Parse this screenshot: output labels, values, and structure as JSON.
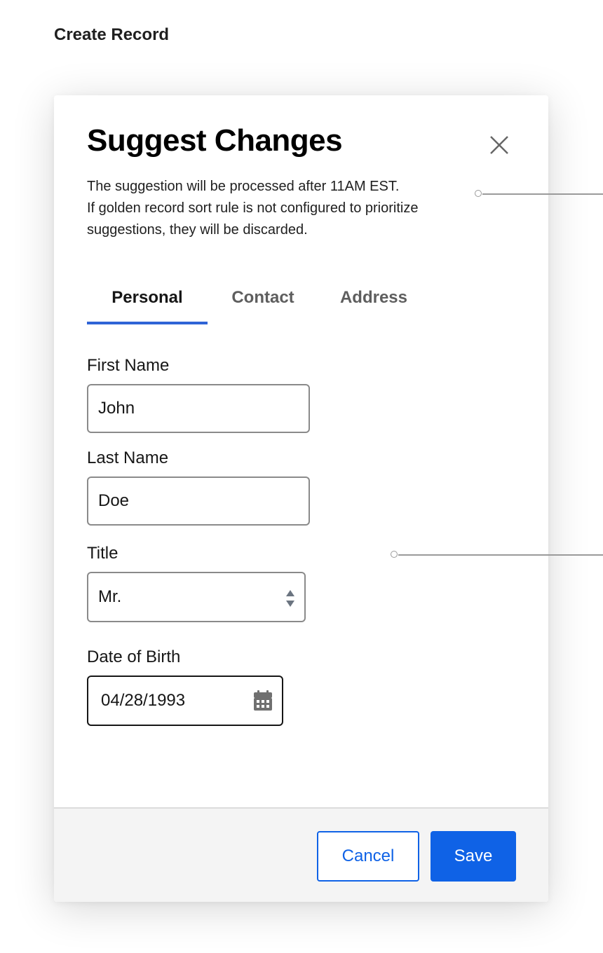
{
  "page": {
    "heading": "Create Record"
  },
  "modal": {
    "title": "Suggest Changes",
    "description": [
      "The suggestion will be processed after 11AM EST.",
      "If golden record sort rule is not configured to prioritize",
      "suggestions, they will be discarded."
    ],
    "close_icon": "close-icon",
    "tabs": [
      {
        "label": "Personal",
        "active": true
      },
      {
        "label": "Contact",
        "active": false
      },
      {
        "label": "Address",
        "active": false
      }
    ],
    "fields": {
      "first_name": {
        "label": "First Name",
        "value": "John"
      },
      "last_name": {
        "label": "Last Name",
        "value": "Doe"
      },
      "title": {
        "label": "Title",
        "value": "Mr."
      },
      "dob": {
        "label": "Date of Birth",
        "value": "04/28/1993"
      }
    },
    "footer": {
      "cancel_label": "Cancel",
      "save_label": "Save"
    }
  },
  "colors": {
    "accent": "#0f62e6",
    "tab_indicator": "#2f64d6",
    "footer_bg": "#f4f4f4",
    "annotation_line": "#9a9a9a"
  }
}
